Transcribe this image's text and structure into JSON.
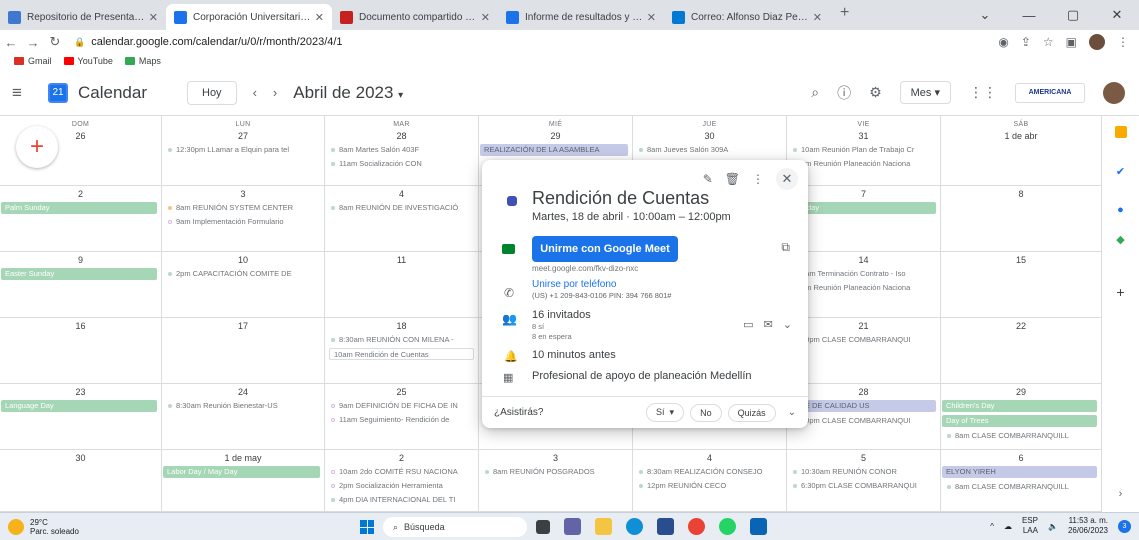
{
  "browser": {
    "tabs": [
      {
        "title": "Repositorio de Presentaciones d",
        "color": "#3f78d1",
        "active": false
      },
      {
        "title": "Corporación Universitaria Ameri",
        "color": "#1a73e8",
        "active": true
      },
      {
        "title": "Documento compartido contigo",
        "color": "#c5221f",
        "active": false
      },
      {
        "title": "Informe de resultados y evaluaci",
        "color": "#1a73e8",
        "active": false
      },
      {
        "title": "Correo: Alfonso Diaz Pertuz - Ou",
        "color": "#0078d4",
        "active": false
      }
    ],
    "new_tab": "+",
    "url": "calendar.google.com/calendar/u/0/r/month/2023/4/1",
    "bookmarks": [
      {
        "label": "Gmail",
        "color": "#d93025"
      },
      {
        "label": "YouTube",
        "color": "#ff0000"
      },
      {
        "label": "Maps",
        "color": "#34a853"
      }
    ]
  },
  "calendar": {
    "app_name": "Calendar",
    "logo_day": "21",
    "today_label": "Hoy",
    "month_title": "Abril de 2023",
    "view_label": "Mes",
    "org_logo": "AMERICANA",
    "days_of_week": [
      "DOM",
      "LUN",
      "MAR",
      "MIÉ",
      "JUE",
      "VIE",
      "SÁB"
    ],
    "weeks": [
      {
        "days": [
          {
            "num": "26",
            "events": []
          },
          {
            "num": "27",
            "events": [
              {
                "text": "12:30pm LLamar a Elquin para tel",
                "kind": "dot"
              }
            ]
          },
          {
            "num": "28",
            "events": [
              {
                "text": "8am Martes Salón 403F",
                "kind": "dot"
              },
              {
                "text": "11am Socialización CON",
                "kind": "dot"
              }
            ]
          },
          {
            "num": "29",
            "events": [
              {
                "text": "REALIZACIÓN DE LA ASAMBLEA",
                "kind": "lav"
              }
            ]
          },
          {
            "num": "30",
            "events": [
              {
                "text": "8am Jueves Salón 309A",
                "kind": "dot"
              }
            ]
          },
          {
            "num": "31",
            "events": [
              {
                "text": "10am Reunión Plan de Trabajo Cr",
                "kind": "dot"
              },
              {
                "text": "pm Reunión Planeación Naciona",
                "kind": "dot"
              }
            ]
          },
          {
            "num": "1 de abr",
            "events": []
          }
        ]
      },
      {
        "days": [
          {
            "num": "2",
            "events": [
              {
                "text": "Palm Sunday",
                "kind": "green"
              }
            ]
          },
          {
            "num": "3",
            "events": [
              {
                "text": "8am REUNIÓN SYSTEM CENTER",
                "kind": "orange"
              },
              {
                "text": "9am Implementación Formulario",
                "kind": "hollow"
              }
            ]
          },
          {
            "num": "4",
            "events": [
              {
                "text": "8am REUNIÓN DE INVESTIGACIÓ",
                "kind": "dot"
              }
            ]
          },
          {
            "num": "5",
            "events": []
          },
          {
            "num": "6",
            "events": []
          },
          {
            "num": "7",
            "events": [
              {
                "text": "d Friday",
                "kind": "green"
              }
            ]
          },
          {
            "num": "8",
            "events": []
          }
        ]
      },
      {
        "days": [
          {
            "num": "9",
            "events": [
              {
                "text": "Easter Sunday",
                "kind": "green"
              }
            ]
          },
          {
            "num": "10",
            "events": [
              {
                "text": "2pm CAPACITACIÓN COMITE DE",
                "kind": "dot"
              }
            ]
          },
          {
            "num": "11",
            "events": []
          },
          {
            "num": "12",
            "events": []
          },
          {
            "num": "13",
            "events": []
          },
          {
            "num": "14",
            "events": [
              {
                "text": "0am Terminación Contrato - Iso",
                "kind": "dot"
              },
              {
                "text": "pm Reunión Planeación Naciona",
                "kind": "dot"
              }
            ]
          },
          {
            "num": "15",
            "events": []
          }
        ]
      },
      {
        "days": [
          {
            "num": "16",
            "events": []
          },
          {
            "num": "17",
            "events": []
          },
          {
            "num": "18",
            "events": [
              {
                "text": "8:30am REUNIÓN CON MILENA -",
                "kind": "dot"
              },
              {
                "text": "10am Rendición de Cuentas",
                "kind": "outline"
              }
            ]
          },
          {
            "num": "19",
            "events": []
          },
          {
            "num": "20",
            "events": []
          },
          {
            "num": "21",
            "events": [
              {
                "text": "30pm CLASE COMBARRANQUI",
                "kind": "dot"
              }
            ]
          },
          {
            "num": "22",
            "events": []
          }
        ]
      },
      {
        "days": [
          {
            "num": "23",
            "events": [
              {
                "text": "Language Day",
                "kind": "green"
              }
            ]
          },
          {
            "num": "24",
            "events": [
              {
                "text": "8:30am Reunión Bienestar-US",
                "kind": "dot"
              }
            ]
          },
          {
            "num": "25",
            "events": [
              {
                "text": "9am DEFINICIÓN DE FICHA DE IN",
                "kind": "hollow"
              },
              {
                "text": "11am Seguimiento- Rendición de",
                "kind": "hollow"
              }
            ]
          },
          {
            "num": "26",
            "events": []
          },
          {
            "num": "27",
            "events": []
          },
          {
            "num": "28",
            "events": [
              {
                "text": "MITÉ DE CALIDAD US",
                "kind": "lav"
              },
              {
                "text": "30pm CLASE COMBARRANQUI",
                "kind": "dot"
              }
            ]
          },
          {
            "num": "29",
            "events": [
              {
                "text": "Children's Day",
                "kind": "green"
              },
              {
                "text": "Day of Trees",
                "kind": "green"
              },
              {
                "text": "8am CLASE COMBARRANQUILL",
                "kind": "dot"
              }
            ]
          }
        ]
      },
      {
        "days": [
          {
            "num": "30",
            "events": []
          },
          {
            "num": "1 de may",
            "events": [
              {
                "text": "Labor Day / May Day",
                "kind": "green"
              }
            ]
          },
          {
            "num": "2",
            "events": [
              {
                "text": "10am 2do COMITÉ RSU NACIONA",
                "kind": "hollow"
              },
              {
                "text": "2pm Socialización Herramienta",
                "kind": "hollow"
              },
              {
                "text": "4pm DIA INTERNACIONAL DEL TI",
                "kind": "dot"
              }
            ]
          },
          {
            "num": "3",
            "events": [
              {
                "text": "8am REUNIÓN POSGRADOS",
                "kind": "dot"
              }
            ]
          },
          {
            "num": "4",
            "events": [
              {
                "text": "8:30am REALIZACIÓN CONSEJO",
                "kind": "dot"
              },
              {
                "text": "12pm REUNIÓN CECO",
                "kind": "dot"
              }
            ]
          },
          {
            "num": "5",
            "events": [
              {
                "text": "10:30am REUNIÓN CONOR",
                "kind": "dot"
              },
              {
                "text": "6:30pm CLASE COMBARRANQUI",
                "kind": "dot"
              }
            ]
          },
          {
            "num": "6",
            "events": [
              {
                "text": "ELYON YIREH",
                "kind": "lav"
              },
              {
                "text": "8am CLASE COMBARRANQUILL",
                "kind": "dot"
              }
            ]
          }
        ]
      }
    ]
  },
  "popup": {
    "title": "Rendición de Cuentas",
    "date": "Martes, 18 de abril  ·  10:00am – 12:00pm",
    "meet_button": "Unirme con Google Meet",
    "meet_url": "meet.google.com/fkv-dizo-nxc",
    "phone_link": "Unirse por teléfono",
    "phone_detail": "(US) +1 209-843-0106 PIN: 394 766 801#",
    "guests_title": "16 invitados",
    "guests_yes": "8 sí",
    "guests_waiting": "8 en espera",
    "reminder": "10 minutos antes",
    "owner": "Profesional de apoyo de planeación Medellín",
    "rsvp_question": "¿Asistirás?",
    "rsvp_yes": "Sí",
    "rsvp_no": "No",
    "rsvp_maybe": "Quizás",
    "event_color": "#4051b5"
  },
  "taskbar": {
    "temp": "29°C",
    "weather": "Parc. soleado",
    "search_placeholder": "Búsqueda",
    "lang": "ESP",
    "lang2": "LAA",
    "time": "11:53 a. m.",
    "date": "26/06/2023",
    "notif_count": "3"
  }
}
